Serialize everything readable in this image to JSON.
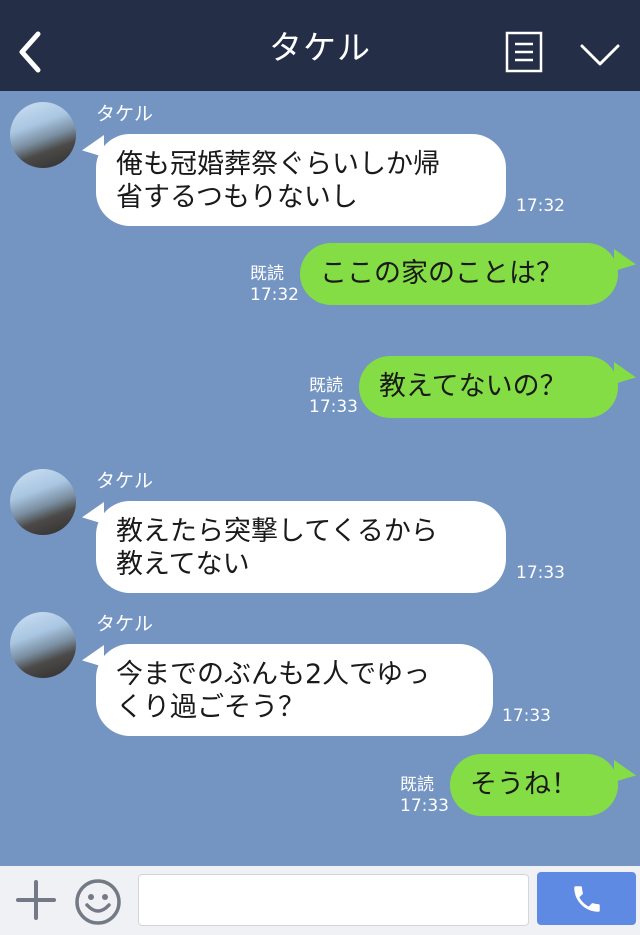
{
  "header": {
    "title": "タケル"
  },
  "messages": [
    {
      "sender": "タケル",
      "lines": [
        "俺も冠婚葬祭ぐらいしか帰",
        "省するつもりないし"
      ],
      "time": "17:32"
    },
    {
      "read": "既読",
      "lines": [
        "ここの家のことは？"
      ],
      "time": "17:32"
    },
    {
      "read": "既読",
      "lines": [
        "教えてないの？"
      ],
      "time": "17:33"
    },
    {
      "sender": "タケル",
      "lines": [
        "教えたら突撃してくるから",
        "教えてない"
      ],
      "time": "17:33"
    },
    {
      "sender": "タケル",
      "lines": [
        "今までのぶんも2人でゆっ",
        "くり過ごそう？"
      ],
      "time": "17:33"
    },
    {
      "read": "既読",
      "lines": [
        "そうね！"
      ],
      "time": "17:33"
    }
  ],
  "composer": {
    "input_value": ""
  },
  "colors": {
    "header_bg": "#242e47",
    "chat_bg": "#7494c2",
    "outgoing_bubble": "#84dd45",
    "incoming_bubble": "#ffffff",
    "call_button": "#5f8ae3"
  },
  "icons": [
    "back-icon",
    "menu-list-icon",
    "chevron-down-icon",
    "plus-icon",
    "emoji-icon",
    "phone-icon"
  ]
}
